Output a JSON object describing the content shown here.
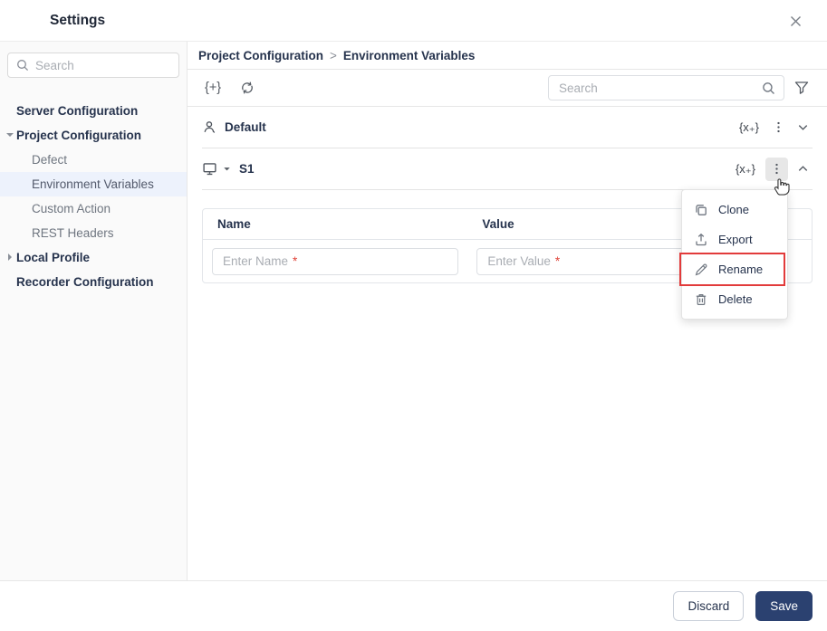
{
  "window": {
    "title": "Settings"
  },
  "sidebar": {
    "search_placeholder": "Search",
    "items": [
      {
        "label": "Server Configuration"
      },
      {
        "label": "Project Configuration",
        "expanded": true
      },
      {
        "label": "Defect"
      },
      {
        "label": "Environment Variables",
        "selected": true
      },
      {
        "label": "Custom Action"
      },
      {
        "label": "REST Headers"
      },
      {
        "label": "Local Profile",
        "collapsed": true
      },
      {
        "label": "Recorder Configuration"
      }
    ]
  },
  "breadcrumb": {
    "first": "Project Configuration",
    "separator": ">",
    "second": "Environment Variables"
  },
  "toolbar": {
    "add_variable_set_icon": "{+}",
    "search_placeholder": "Search"
  },
  "sections": [
    {
      "name": "Default",
      "variable_add_icon": "{x₊}",
      "state": "collapsed"
    },
    {
      "name": "S1",
      "variable_add_icon": "{x₊}",
      "state": "expanded"
    }
  ],
  "table": {
    "columns": [
      "Name",
      "Value"
    ],
    "name_placeholder": "Enter Name",
    "value_placeholder": "Enter Value",
    "required_marker": "*"
  },
  "context_menu": {
    "items": [
      {
        "label": "Clone",
        "icon": "clone-icon"
      },
      {
        "label": "Export",
        "icon": "export-icon"
      },
      {
        "label": "Rename",
        "icon": "rename-icon",
        "highlighted": true
      },
      {
        "label": "Delete",
        "icon": "delete-icon"
      }
    ]
  },
  "footer": {
    "discard": "Discard",
    "save": "Save"
  },
  "colors": {
    "primary_navy": "#2b4170",
    "text_primary": "#26334d",
    "selected_item_bg": "#edf2fc",
    "highlight_red": "#e23b3b",
    "required_red": "#e0443a"
  }
}
